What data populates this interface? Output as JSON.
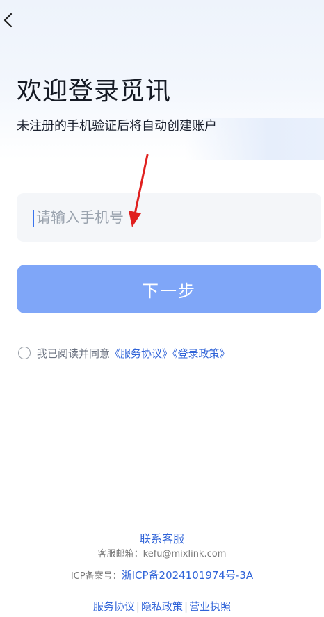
{
  "header": {
    "back_icon": "chevron-left-icon"
  },
  "hero": {
    "title": "欢迎登录觅讯",
    "subtitle": "未注册的手机验证后将自动创建账户"
  },
  "form": {
    "phone_placeholder": "请输入手机号",
    "phone_value": "",
    "next_label": "下一步",
    "next_color": "#7fa6f8"
  },
  "agreement": {
    "checked": false,
    "prefix": "我已阅读并同意",
    "service_link": "《服务协议》",
    "policy_link": "《登录政策》"
  },
  "footer": {
    "contact_label": "联系客服",
    "email_line": "客服邮箱：kefu@mixlink.com",
    "icp_prefix": "ICP备案号：",
    "icp_number": "浙ICP备2024101974号-3A",
    "links": [
      "服务协议",
      "隐私政策",
      "营业执照"
    ],
    "separator": "|"
  },
  "colors": {
    "accent": "#2f63d8",
    "annotation_arrow": "#e0201f"
  }
}
